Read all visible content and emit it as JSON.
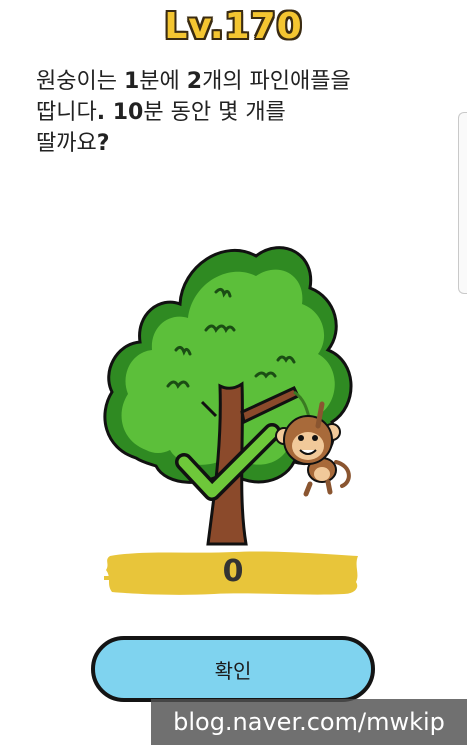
{
  "level": {
    "title": "Lv.170"
  },
  "question": {
    "line1": [
      {
        "t": "원숭이는 ",
        "b": false
      },
      {
        "t": "1",
        "b": true
      },
      {
        "t": "분에 ",
        "b": false
      },
      {
        "t": "2",
        "b": true
      },
      {
        "t": "개의 파인애플을",
        "b": false
      }
    ],
    "line2": [
      {
        "t": "땁니다",
        "b": false
      },
      {
        "t": ". 10",
        "b": true
      },
      {
        "t": "분 동안 몇 개를",
        "b": false
      }
    ],
    "line3": [
      {
        "t": "딸까요",
        "b": false
      },
      {
        "t": "?",
        "b": true
      }
    ]
  },
  "answer": {
    "value": "0"
  },
  "confirm_button": {
    "label": "확인"
  },
  "watermark": {
    "text": "blog.naver.com/mwkip"
  },
  "colors": {
    "title_fill": "#f4c531",
    "foliage": "#5cbf3a",
    "foliage_dark": "#2f8a22",
    "trunk": "#8b4a2b",
    "check": "#6ec83a",
    "answer_bar": "#e8c53a",
    "button_fill": "#7fd3ef"
  },
  "icons": {
    "check": "check-mark-icon",
    "monkey": "monkey-icon"
  }
}
